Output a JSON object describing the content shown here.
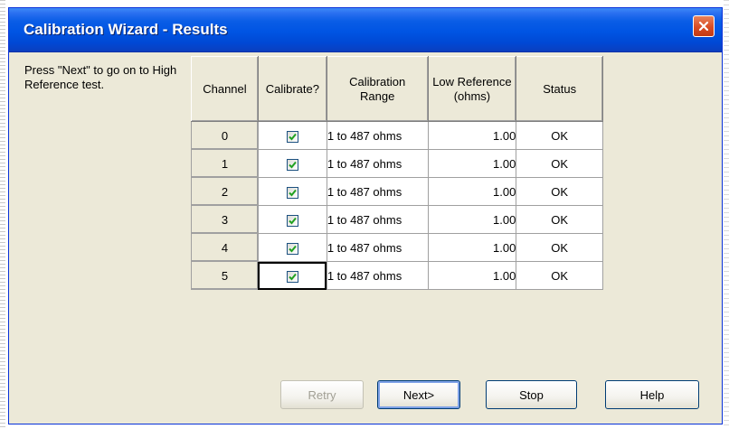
{
  "window": {
    "title": "Calibration Wizard - Results"
  },
  "instructions": "Press \"Next\" to go on to High Reference test.",
  "table": {
    "columns": [
      "Channel",
      "Calibrate?",
      "Calibration Range",
      "Low Reference (ohms)",
      "Status"
    ],
    "rows": [
      {
        "channel": "0",
        "calibrate": true,
        "range": "1 to 487 ohms",
        "low": "1.00",
        "status": "OK"
      },
      {
        "channel": "1",
        "calibrate": true,
        "range": "1 to 487 ohms",
        "low": "1.00",
        "status": "OK"
      },
      {
        "channel": "2",
        "calibrate": true,
        "range": "1 to 487 ohms",
        "low": "1.00",
        "status": "OK"
      },
      {
        "channel": "3",
        "calibrate": true,
        "range": "1 to 487 ohms",
        "low": "1.00",
        "status": "OK"
      },
      {
        "channel": "4",
        "calibrate": true,
        "range": "1 to 487 ohms",
        "low": "1.00",
        "status": "OK"
      },
      {
        "channel": "5",
        "calibrate": true,
        "range": "1 to 487 ohms",
        "low": "1.00",
        "status": "OK"
      }
    ]
  },
  "buttons": {
    "retry": "Retry",
    "next": "Next>",
    "stop": "Stop",
    "help": "Help"
  },
  "colors": {
    "titlebar": "#0054e3",
    "dialog_face": "#ece9d8",
    "checkmark": "#21a121",
    "close_button": "#d94c24"
  }
}
